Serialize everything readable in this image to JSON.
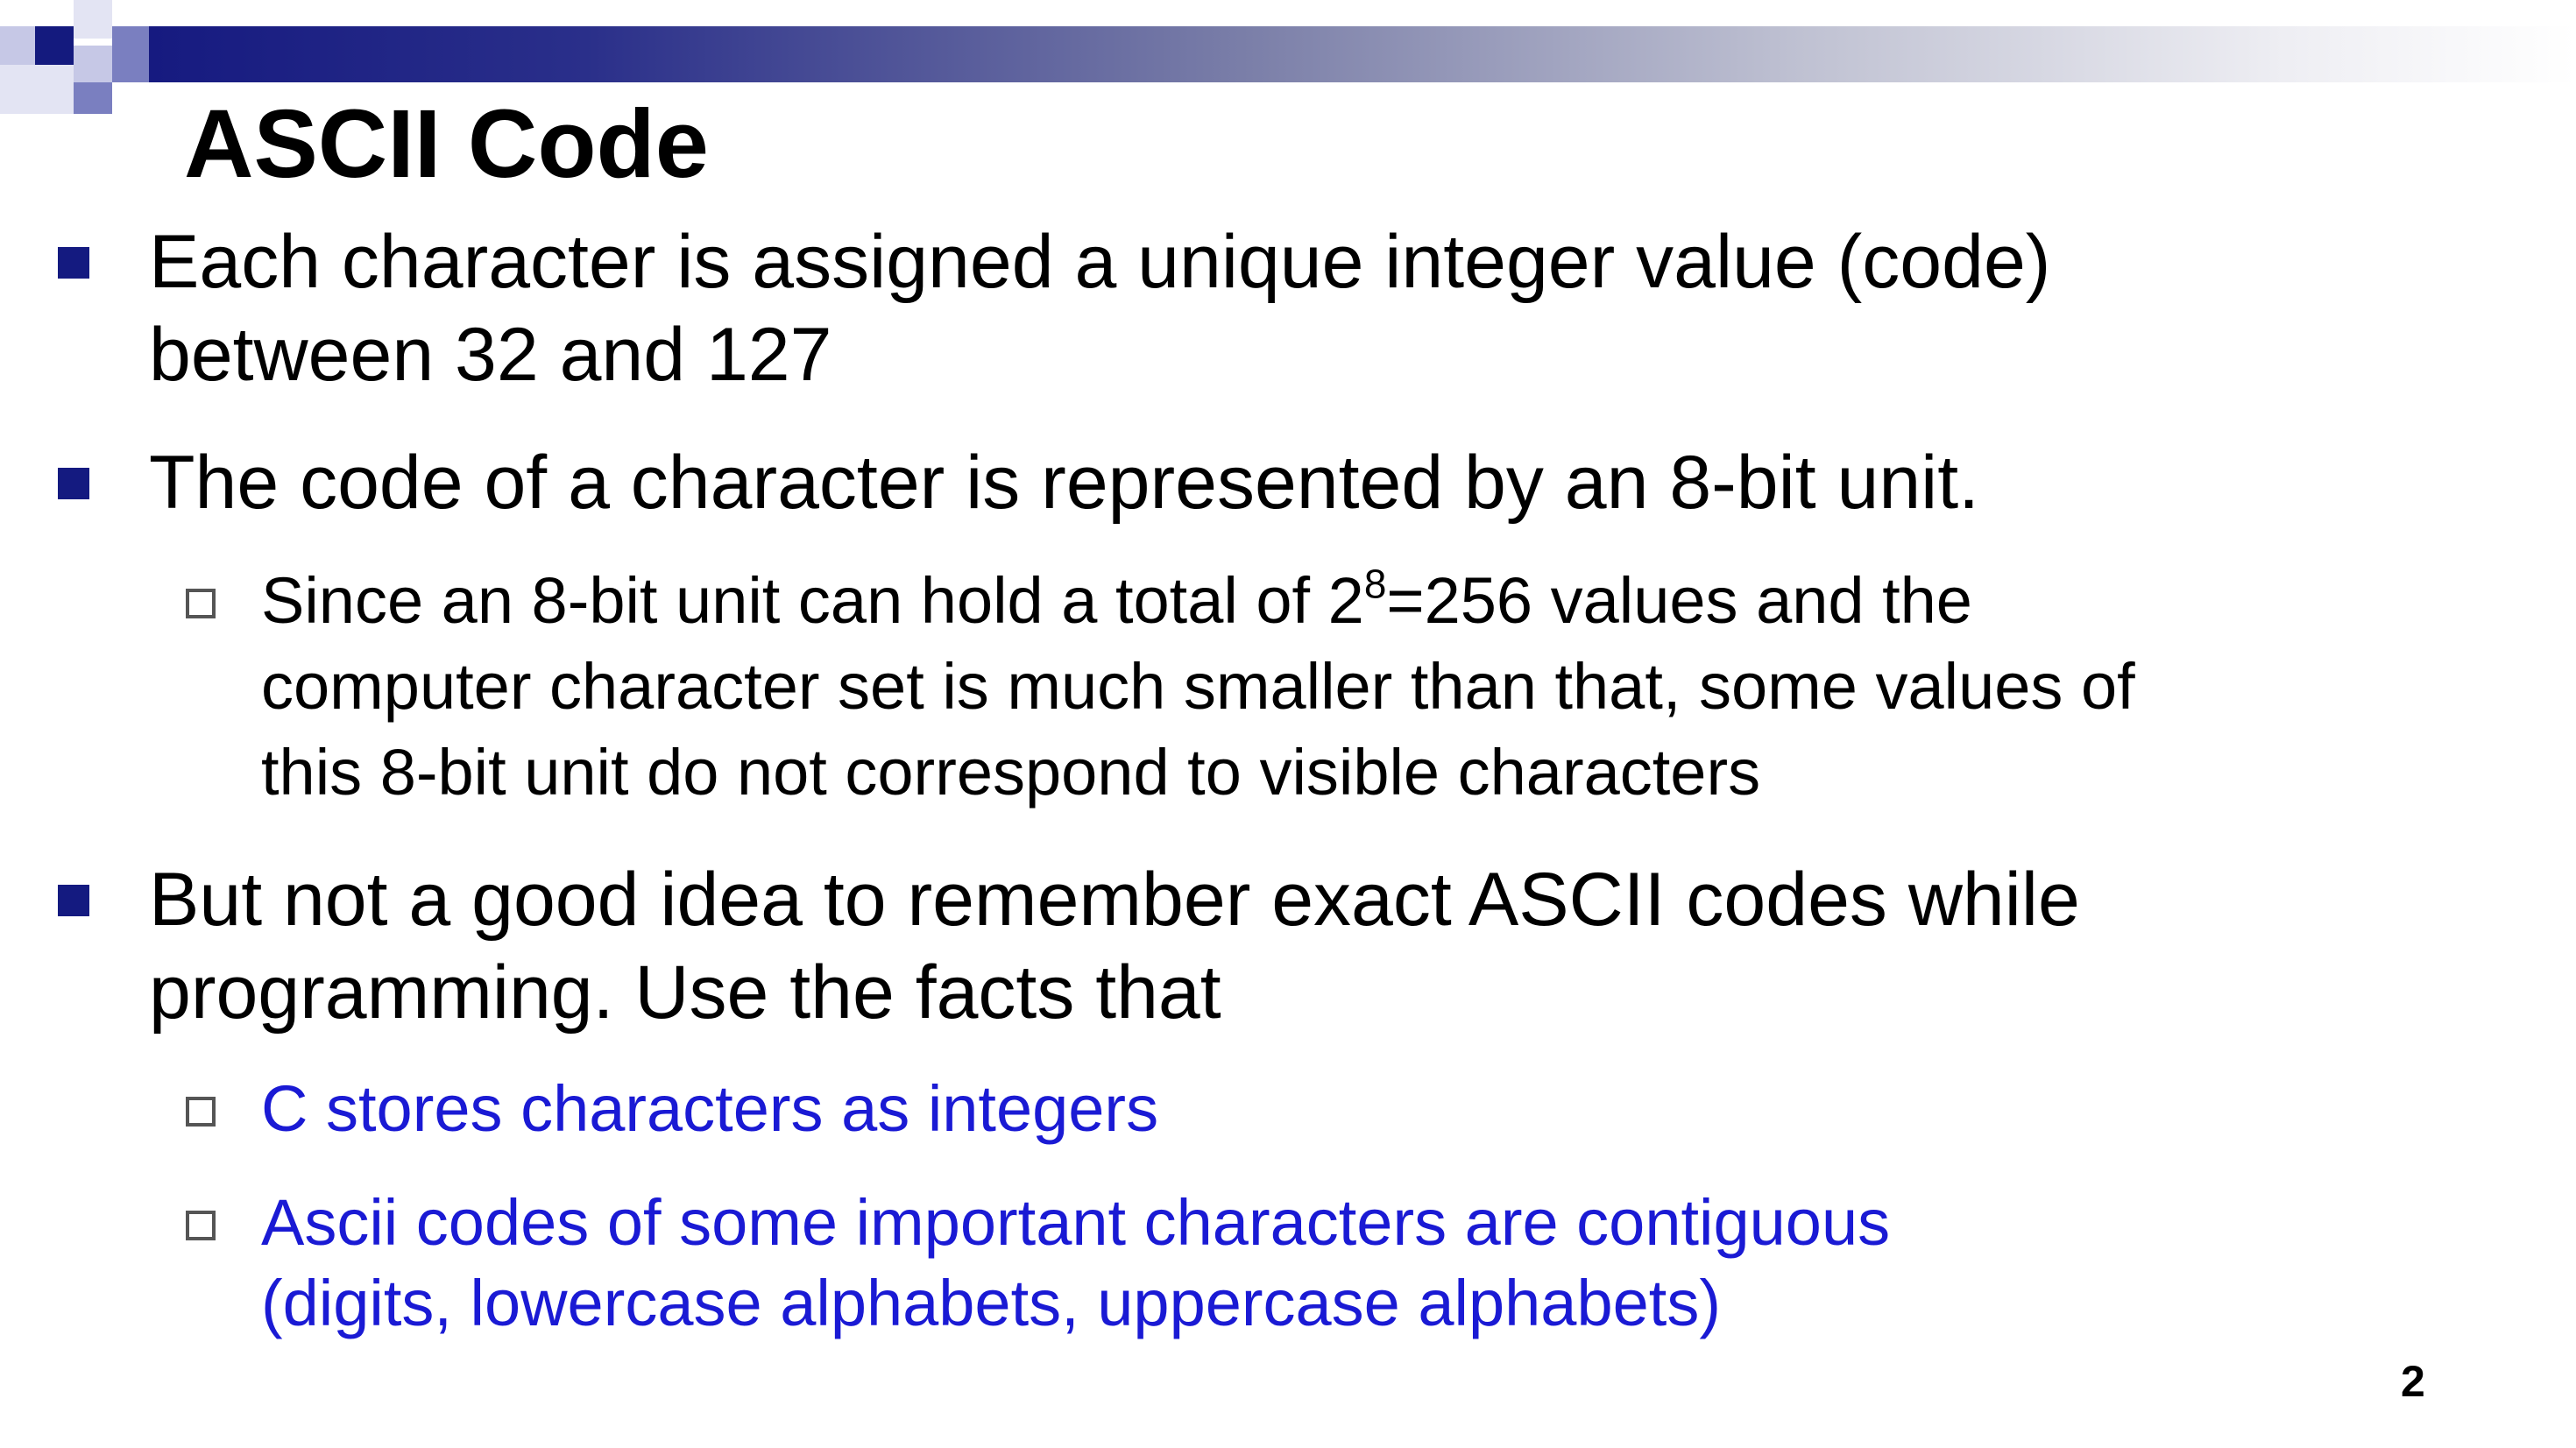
{
  "slide": {
    "title": "ASCII Code",
    "page_number": "2",
    "colors": {
      "bullet": "#141a80",
      "highlight_text": "#1a1ad4",
      "bar_start": "#161a80"
    },
    "bullets": [
      {
        "lines": [
          "Each character is assigned a unique integer value (code)",
          "between 32 and 127"
        ]
      },
      {
        "lines": [
          "The code of a character is represented by an 8-bit unit."
        ],
        "sub": {
          "line1_before": "Since an 8-bit unit can hold a total of 2",
          "line1_sup": "8",
          "line1_after": "=256 values and the",
          "line2": "computer character set is much smaller than that, some values of",
          "line3": "this 8-bit unit do not correspond to visible characters"
        }
      },
      {
        "lines": [
          "But not a good idea to remember exact ASCII codes while",
          "programming. Use the facts that"
        ],
        "subs": [
          {
            "lines": [
              "C stores characters as integers"
            ]
          },
          {
            "lines": [
              "Ascii codes of some important characters are contiguous",
              "(digits, lowercase alphabets, uppercase alphabets)"
            ]
          }
        ]
      }
    ]
  }
}
